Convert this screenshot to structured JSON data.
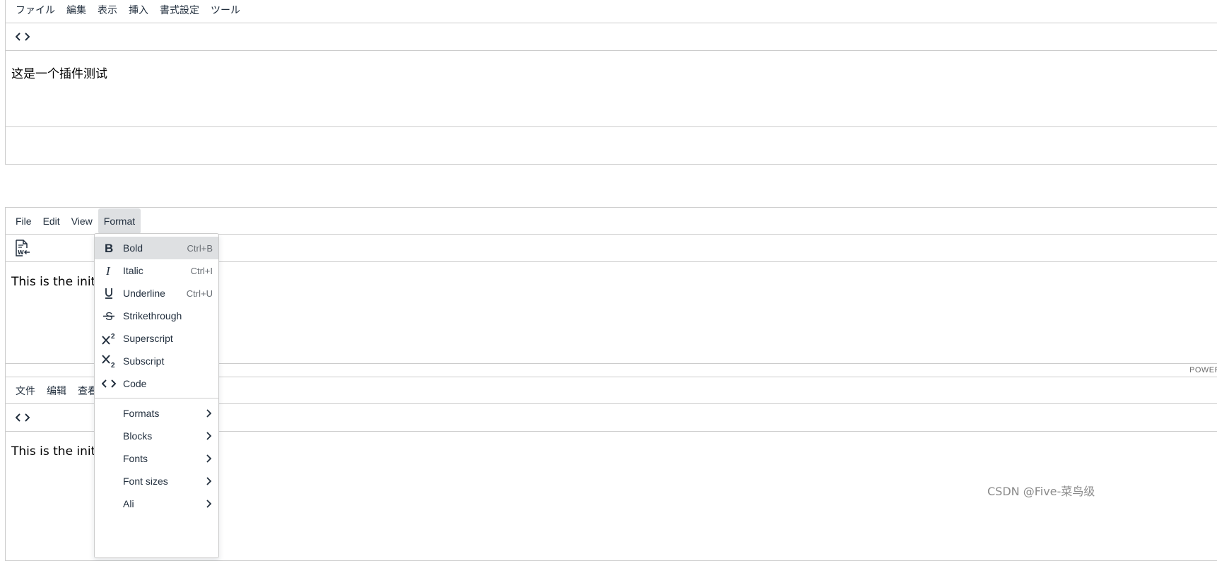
{
  "editor1": {
    "menu": [
      "ファイル",
      "編集",
      "表示",
      "挿入",
      "書式設定",
      "ツール"
    ],
    "toolbar_icon": "code-icon",
    "content": "这是一个插件测试"
  },
  "editor2": {
    "menu": [
      "File",
      "Edit",
      "View",
      "Format"
    ],
    "active_menu": "Format",
    "toolbar_icon": "import-word-icon",
    "content": "This is the initia",
    "status_text": "POWER"
  },
  "editor3": {
    "menu": [
      "文件",
      "编辑",
      "查看"
    ],
    "toolbar_icon": "code-icon",
    "content": "This is the initia"
  },
  "format_menu": {
    "items": [
      {
        "label": "Bold",
        "shortcut": "Ctrl+B",
        "icon": "bold-icon"
      },
      {
        "label": "Italic",
        "shortcut": "Ctrl+I",
        "icon": "italic-icon"
      },
      {
        "label": "Underline",
        "shortcut": "Ctrl+U",
        "icon": "underline-icon"
      },
      {
        "label": "Strikethrough",
        "shortcut": "",
        "icon": "strikethrough-icon"
      },
      {
        "label": "Superscript",
        "shortcut": "",
        "icon": "superscript-icon"
      },
      {
        "label": "Subscript",
        "shortcut": "",
        "icon": "subscript-icon"
      },
      {
        "label": "Code",
        "shortcut": "",
        "icon": "code-icon"
      }
    ],
    "submenus": [
      "Formats",
      "Blocks",
      "Fonts",
      "Font sizes",
      "Ali"
    ]
  },
  "watermark": "CSDN @Five-菜鸟级",
  "colors": {
    "border": "#cccccc",
    "active_bg": "#dee0e2",
    "text": "#222f3e"
  }
}
